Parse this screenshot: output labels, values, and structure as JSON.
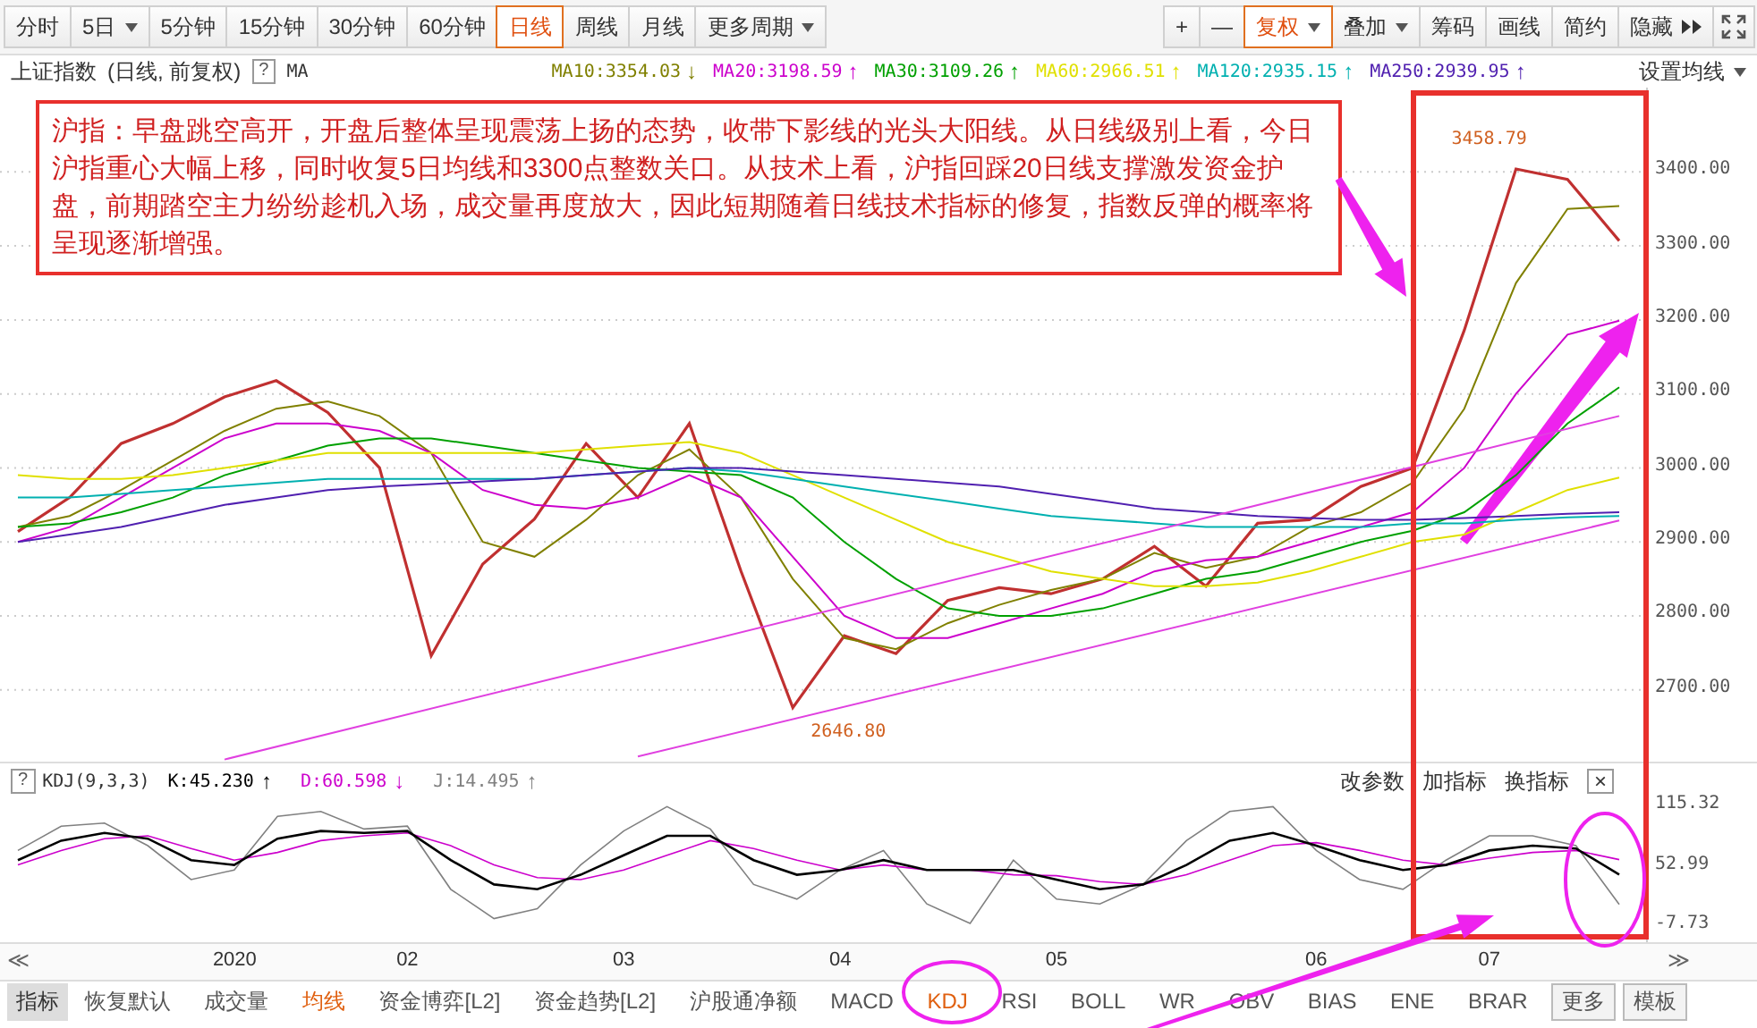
{
  "period_tabs": [
    {
      "label": "分时",
      "dropdown": false,
      "selected": false
    },
    {
      "label": "5日",
      "dropdown": true,
      "selected": false
    },
    {
      "label": "5分钟",
      "dropdown": false,
      "selected": false
    },
    {
      "label": "15分钟",
      "dropdown": false,
      "selected": false
    },
    {
      "label": "30分钟",
      "dropdown": false,
      "selected": false
    },
    {
      "label": "60分钟",
      "dropdown": false,
      "selected": false
    },
    {
      "label": "日线",
      "dropdown": false,
      "selected": true
    },
    {
      "label": "周线",
      "dropdown": false,
      "selected": false
    },
    {
      "label": "月线",
      "dropdown": false,
      "selected": false
    },
    {
      "label": "更多周期",
      "dropdown": true,
      "selected": false
    }
  ],
  "tool_buttons": [
    {
      "label": "+",
      "dropdown": false,
      "selected": false
    },
    {
      "label": "—",
      "dropdown": false,
      "selected": false
    },
    {
      "label": "复权",
      "dropdown": true,
      "selected": true
    },
    {
      "label": "叠加",
      "dropdown": true,
      "selected": false
    },
    {
      "label": "筹码",
      "dropdown": false,
      "selected": false
    },
    {
      "label": "画线",
      "dropdown": false,
      "selected": false
    },
    {
      "label": "简约",
      "dropdown": false,
      "selected": false
    },
    {
      "label": "隐藏",
      "dropdown": false,
      "selected": false
    }
  ],
  "info_bar": {
    "symbol": "上证指数",
    "mode": "(日线, 前复权)",
    "help": "?",
    "ma_label": "MA",
    "settings": "设置均线",
    "mas": [
      {
        "label": "MA10:3354.03",
        "arrow": "↓",
        "color": "#808000"
      },
      {
        "label": "MA20:3198.59",
        "arrow": "↑",
        "color": "#cc00cc"
      },
      {
        "label": "MA30:3109.26",
        "arrow": "↑",
        "color": "#00a000"
      },
      {
        "label": "MA60:2966.51",
        "arrow": "↑",
        "color": "#e0e000"
      },
      {
        "label": "MA120:2935.15",
        "arrow": "↑",
        "color": "#00b0b0"
      },
      {
        "label": "MA250:2939.95",
        "arrow": "↑",
        "color": "#5020b0"
      }
    ]
  },
  "note": "沪指：早盘跳空高开，开盘后整体呈现震荡上扬的态势，收带下影线的光头大阳线。从日线级别上看，今日沪指重心大幅上移，同时收复5日均线和3300点整数关口。从技术上看，沪指回踩20日线支撑激发资金护盘，前期踏空主力纷纷趁机入场，成交量再度放大，因此短期随着日线技术指标的修复，指数反弹的概率将呈现逐渐增强。",
  "main_chart": {
    "chart_data": {
      "type": "line",
      "categories": [
        null,
        null,
        null,
        null,
        null,
        null,
        null,
        null,
        null,
        null,
        null,
        null,
        null,
        null,
        null,
        null,
        null,
        null,
        null,
        null,
        null,
        null,
        null,
        null,
        null,
        null,
        null,
        null,
        null,
        null,
        null,
        null
      ],
      "grid": true,
      "ylim": [
        2603,
        3514
      ],
      "yticks": [
        {
          "value": 2700,
          "label": "2700.00"
        },
        {
          "value": 2800,
          "label": "2800.00"
        },
        {
          "value": 2900,
          "label": "2900.00"
        },
        {
          "value": 3000,
          "label": "3000.00"
        },
        {
          "value": 3100,
          "label": "3100.00"
        },
        {
          "value": 3200,
          "label": "3200.00"
        },
        {
          "value": 3300,
          "label": "3300.00"
        },
        {
          "value": 3400,
          "label": "3400.00"
        }
      ],
      "series": [
        {
          "color": "#c03030",
          "values": [
            2914,
            2960,
            3033,
            3060,
            3096,
            3118,
            3075,
            3000,
            2746,
            2870,
            2931,
            3033,
            2960,
            3060,
            2860,
            2676,
            2773,
            2749,
            2821,
            2838,
            2830,
            2850,
            2894,
            2840,
            2925,
            2930,
            2975,
            3000,
            3186,
            3404,
            3390,
            3307
          ]
        },
        {
          "color": "#808000",
          "values": [
            2920,
            2935,
            2970,
            3010,
            3050,
            3080,
            3090,
            3070,
            3020,
            2900,
            2880,
            2930,
            2990,
            3025,
            2960,
            2850,
            2770,
            2755,
            2790,
            2815,
            2835,
            2850,
            2885,
            2865,
            2880,
            2920,
            2940,
            2980,
            3080,
            3250,
            3350,
            3354
          ]
        },
        {
          "color": "#cc00cc",
          "values": [
            2900,
            2920,
            2960,
            3000,
            3040,
            3060,
            3060,
            3050,
            3020,
            2970,
            2950,
            2945,
            2960,
            2990,
            2960,
            2880,
            2800,
            2770,
            2770,
            2790,
            2810,
            2830,
            2860,
            2875,
            2880,
            2900,
            2920,
            2940,
            3000,
            3100,
            3180,
            3199
          ]
        },
        {
          "color": "#00a000",
          "values": [
            2920,
            2925,
            2940,
            2960,
            2990,
            3010,
            3030,
            3040,
            3040,
            3030,
            3020,
            3010,
            3000,
            2995,
            2990,
            2960,
            2900,
            2850,
            2810,
            2800,
            2800,
            2810,
            2830,
            2850,
            2860,
            2880,
            2900,
            2915,
            2940,
            2990,
            3060,
            3109
          ]
        },
        {
          "color": "#e0e000",
          "values": [
            2990,
            2985,
            2985,
            2990,
            3000,
            3010,
            3020,
            3020,
            3020,
            3020,
            3020,
            3025,
            3030,
            3035,
            3020,
            2990,
            2960,
            2930,
            2900,
            2880,
            2860,
            2850,
            2840,
            2840,
            2845,
            2860,
            2880,
            2900,
            2910,
            2940,
            2970,
            2987
          ]
        },
        {
          "color": "#00b0b0",
          "values": [
            2960,
            2960,
            2965,
            2970,
            2975,
            2980,
            2985,
            2985,
            2985,
            2985,
            2985,
            2990,
            2995,
            3000,
            2995,
            2985,
            2975,
            2965,
            2955,
            2945,
            2935,
            2930,
            2925,
            2920,
            2920,
            2920,
            2920,
            2925,
            2925,
            2930,
            2933,
            2935
          ]
        },
        {
          "color": "#5020b0",
          "values": [
            2900,
            2910,
            2920,
            2935,
            2950,
            2960,
            2970,
            2975,
            2978,
            2982,
            2985,
            2990,
            2995,
            3000,
            3000,
            2995,
            2990,
            2985,
            2980,
            2975,
            2965,
            2955,
            2945,
            2940,
            2935,
            2932,
            2930,
            2930,
            2932,
            2935,
            2938,
            2940
          ]
        },
        {
          "color": "#e040e0",
          "values": [
            null,
            null,
            null,
            null,
            2606,
            null,
            null,
            null,
            null,
            null,
            null,
            null,
            null,
            null,
            null,
            null,
            null,
            null,
            null,
            null,
            null,
            null,
            null,
            null,
            null,
            null,
            null,
            null,
            null,
            null,
            null,
            3070
          ]
        },
        {
          "color": "#e040e0",
          "values": [
            null,
            null,
            null,
            null,
            null,
            null,
            null,
            null,
            null,
            null,
            null,
            null,
            2610,
            null,
            null,
            null,
            null,
            null,
            null,
            null,
            null,
            null,
            null,
            null,
            null,
            null,
            null,
            null,
            null,
            null,
            null,
            2929
          ]
        }
      ],
      "annotations": [
        "3458.79",
        "2646.80"
      ]
    }
  },
  "kdj": {
    "help": "?",
    "title": "KDJ(9,3,3)",
    "readings": [
      {
        "label": "K:45.230",
        "arrow": "↑",
        "color": "#000000"
      },
      {
        "label": "D:60.598",
        "arrow": "↓",
        "color": "#cc00cc"
      },
      {
        "label": "J:14.495",
        "arrow": "↑",
        "color": "#808080"
      }
    ],
    "actions": [
      "改参数",
      "加指标",
      "换指标"
    ],
    "close": "×",
    "chart_data": {
      "type": "line",
      "categories": [
        null,
        null,
        null,
        null,
        null,
        "2020",
        null,
        null,
        null,
        "02",
        null,
        null,
        null,
        null,
        "03",
        null,
        null,
        null,
        null,
        "04",
        null,
        null,
        null,
        null,
        "05",
        null,
        null,
        null,
        null,
        null,
        "06",
        null,
        null,
        null,
        "07",
        null,
        null,
        null
      ],
      "ylim": [
        -24.3,
        122.7
      ],
      "yticks": [
        {
          "value": 115.32,
          "label": "115.32"
        },
        {
          "value": 52.99,
          "label": "52.99"
        },
        {
          "value": -7.73,
          "label": "-7.73"
        }
      ],
      "series": [
        {
          "color": "#808080",
          "values": [
            70,
            95,
            98,
            75,
            40,
            50,
            105,
            110,
            92,
            95,
            30,
            0,
            10,
            55,
            90,
            115,
            92,
            35,
            20,
            50,
            70,
            15,
            -5,
            60,
            20,
            15,
            35,
            80,
            110,
            115,
            70,
            40,
            30,
            60,
            85,
            85,
            75,
            14.5
          ]
        },
        {
          "color": "#cc00cc",
          "values": [
            55,
            70,
            82,
            85,
            72,
            60,
            68,
            80,
            85,
            88,
            75,
            55,
            42,
            40,
            50,
            65,
            80,
            72,
            60,
            50,
            55,
            50,
            50,
            45,
            44,
            38,
            35,
            45,
            60,
            75,
            78,
            70,
            60,
            55,
            62,
            68,
            70,
            60.6
          ]
        },
        {
          "color": "#000000",
          "values": [
            60,
            80,
            88,
            82,
            60,
            55,
            82,
            90,
            88,
            90,
            60,
            35,
            30,
            45,
            65,
            85,
            85,
            60,
            45,
            50,
            60,
            50,
            50,
            50,
            40,
            30,
            35,
            55,
            80,
            88,
            75,
            60,
            50,
            55,
            70,
            75,
            72,
            45.2
          ]
        }
      ]
    }
  },
  "time_nav": {
    "prev": "≪",
    "next": "≫"
  },
  "indicator_tabs": [
    {
      "label": "指标",
      "kind": "header",
      "on": false
    },
    {
      "label": "恢复默认",
      "kind": "tab",
      "on": false
    },
    {
      "label": "成交量",
      "kind": "tab",
      "on": false
    },
    {
      "label": "均线",
      "kind": "tab",
      "on": true
    },
    {
      "label": "资金博弈[L2]",
      "kind": "tab",
      "on": false
    },
    {
      "label": "资金趋势[L2]",
      "kind": "tab",
      "on": false
    },
    {
      "label": "沪股通净额",
      "kind": "tab",
      "on": false
    },
    {
      "label": "MACD",
      "kind": "tab",
      "on": false
    },
    {
      "label": "KDJ",
      "kind": "tab",
      "on": true
    },
    {
      "label": "RSI",
      "kind": "tab",
      "on": false
    },
    {
      "label": "BOLL",
      "kind": "tab",
      "on": false
    },
    {
      "label": "WR",
      "kind": "tab",
      "on": false
    },
    {
      "label": "OBV",
      "kind": "tab",
      "on": false
    },
    {
      "label": "BIAS",
      "kind": "tab",
      "on": false
    },
    {
      "label": "ENE",
      "kind": "tab",
      "on": false
    },
    {
      "label": "BRAR",
      "kind": "tab",
      "on": false
    },
    {
      "label": "更多",
      "kind": "button",
      "on": false
    },
    {
      "label": "模板",
      "kind": "button",
      "on": false
    }
  ]
}
